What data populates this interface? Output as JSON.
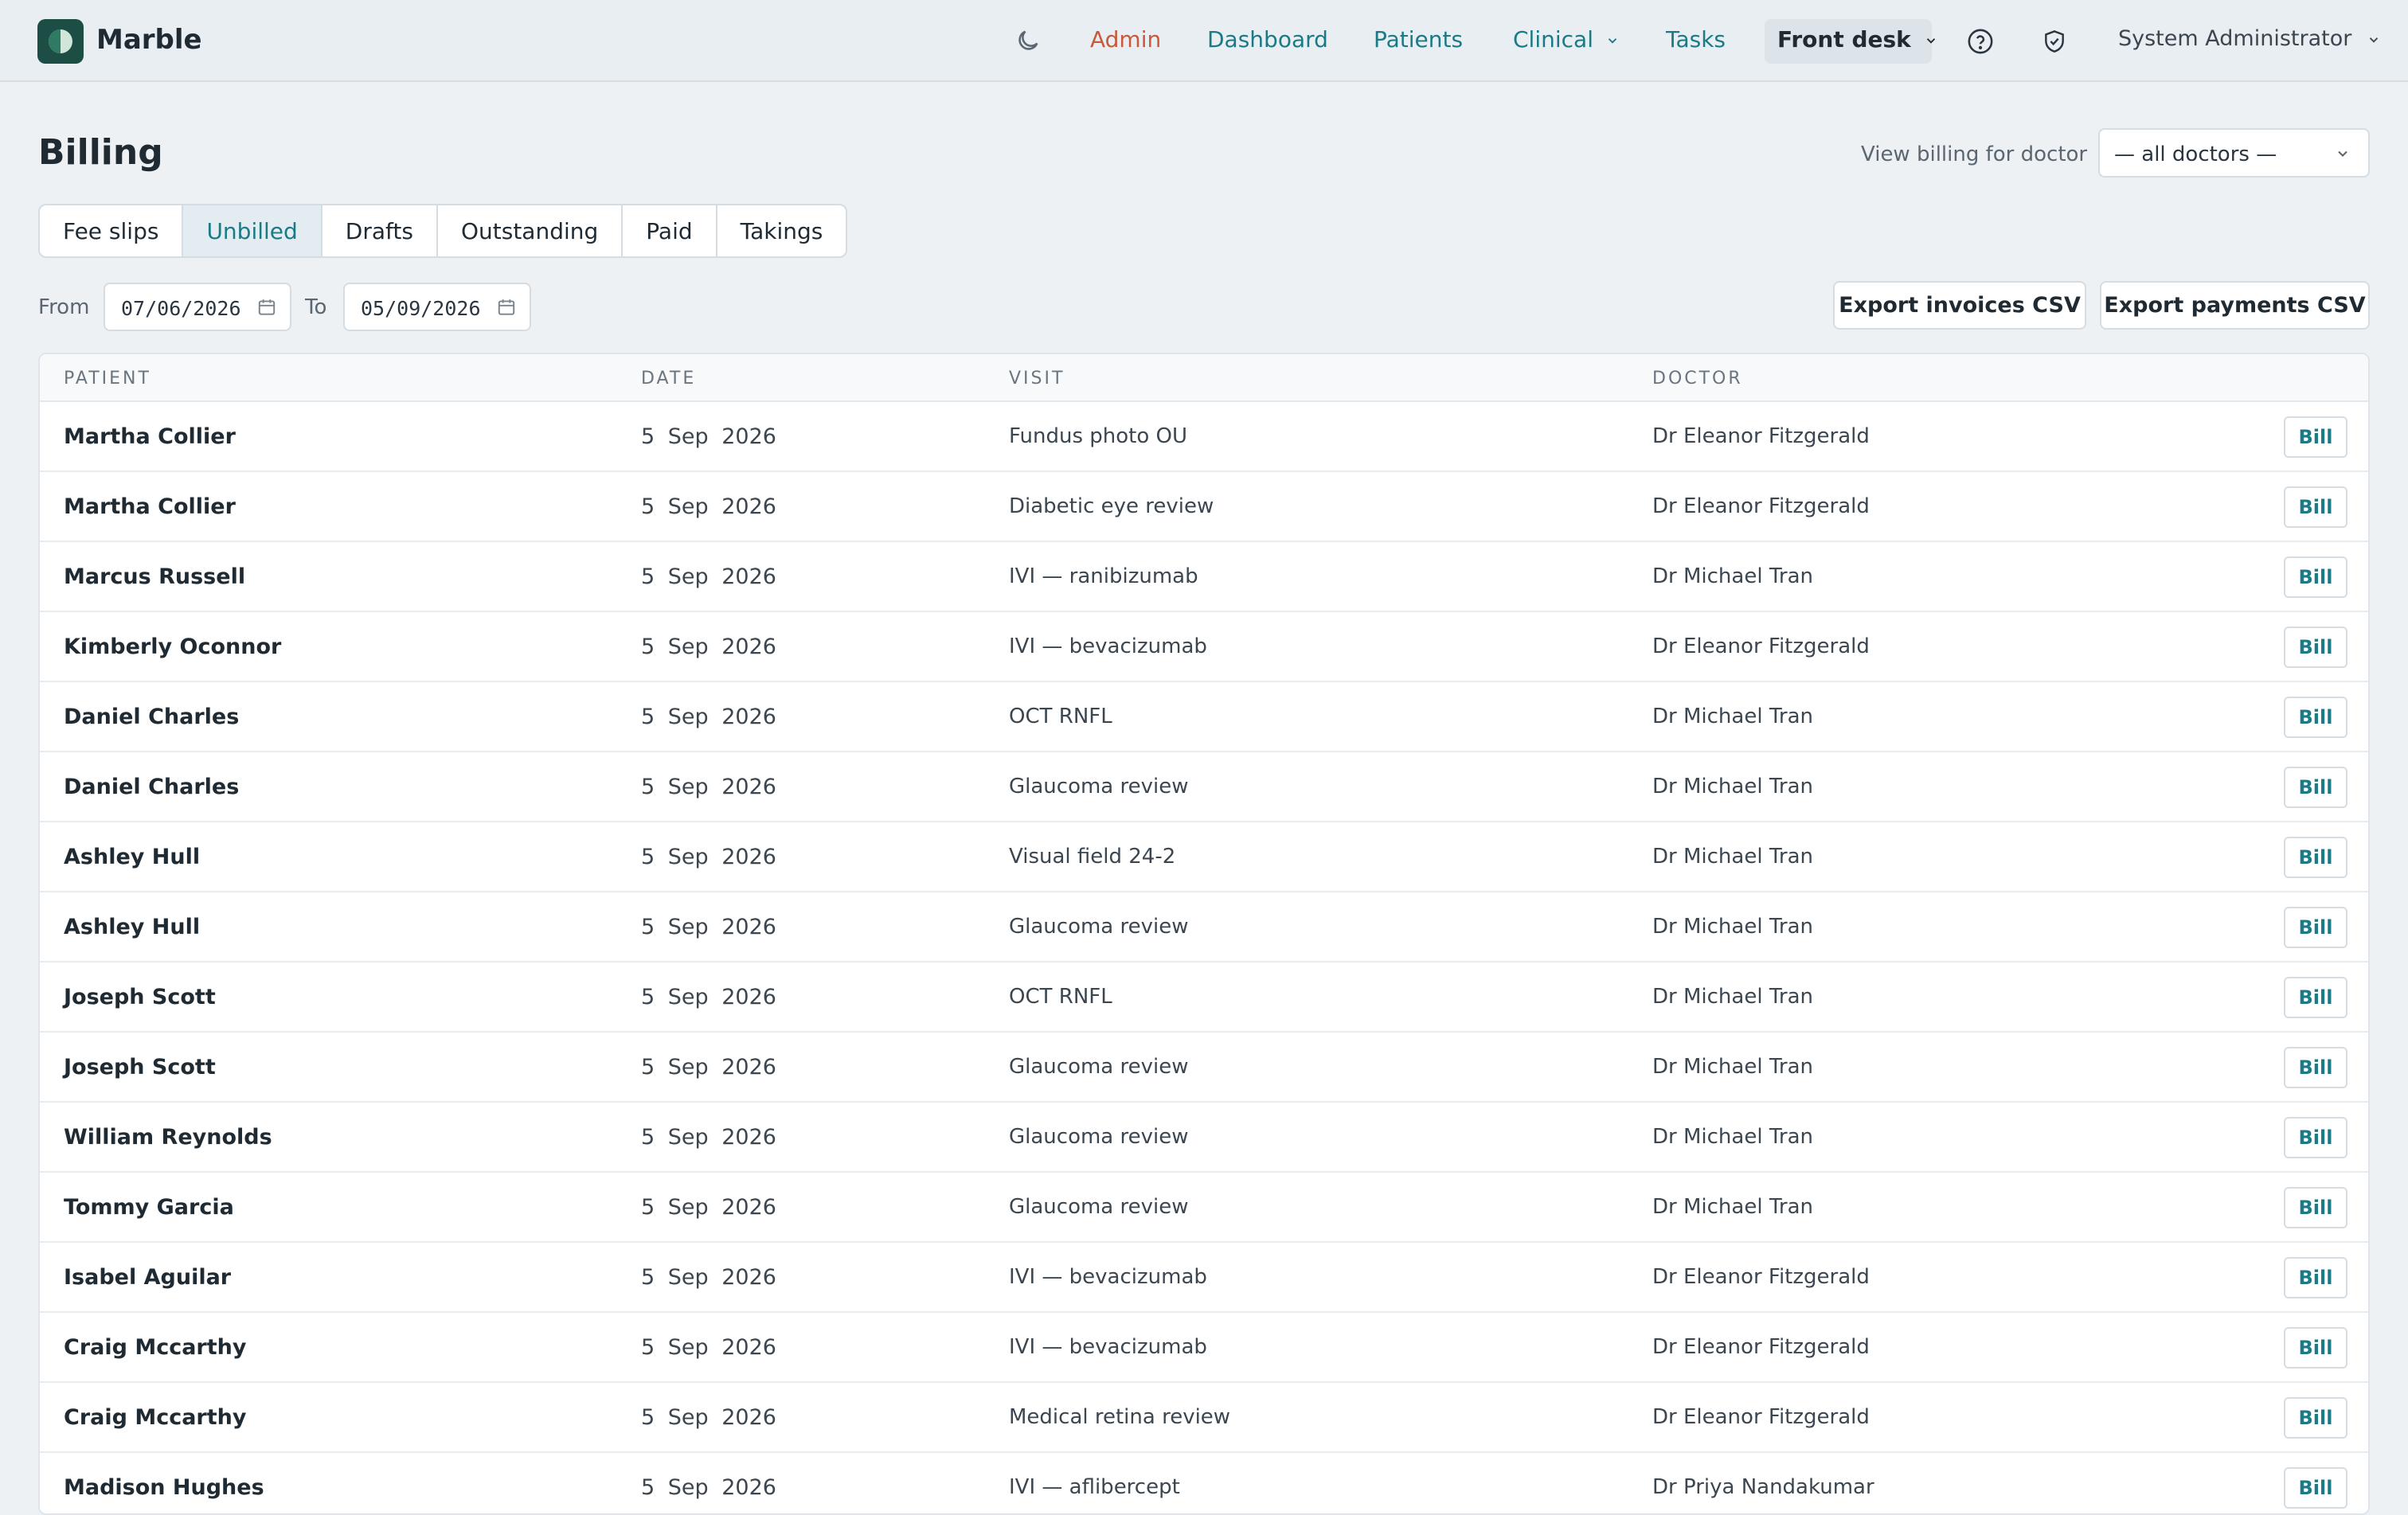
{
  "app": {
    "name": "Marble"
  },
  "nav": {
    "items": [
      {
        "label": "Admin"
      },
      {
        "label": "Dashboard"
      },
      {
        "label": "Patients"
      },
      {
        "label": "Clinical"
      },
      {
        "label": "Tasks"
      },
      {
        "label": "Front desk"
      }
    ],
    "user": "System Administrator"
  },
  "page": {
    "title": "Billing",
    "doctor_filter_label": "View billing for doctor",
    "doctor_filter_value": "— all doctors —"
  },
  "tabs": [
    {
      "label": "Fee slips"
    },
    {
      "label": "Unbilled",
      "active": true
    },
    {
      "label": "Drafts"
    },
    {
      "label": "Outstanding"
    },
    {
      "label": "Paid"
    },
    {
      "label": "Takings"
    }
  ],
  "filters": {
    "from_label": "From",
    "from_value": "07/06/2026",
    "to_label": "To",
    "to_value": "05/09/2026",
    "export_invoices": "Export invoices CSV",
    "export_payments": "Export payments CSV"
  },
  "table": {
    "columns": [
      "PATIENT",
      "DATE",
      "VISIT",
      "DOCTOR"
    ],
    "bill_label": "Bill",
    "rows": [
      {
        "patient": "Martha Collier",
        "date": "5 Sep 2026",
        "visit": "Fundus photo OU",
        "doctor": "Dr Eleanor Fitzgerald"
      },
      {
        "patient": "Martha Collier",
        "date": "5 Sep 2026",
        "visit": "Diabetic eye review",
        "doctor": "Dr Eleanor Fitzgerald"
      },
      {
        "patient": "Marcus Russell",
        "date": "5 Sep 2026",
        "visit": "IVI — ranibizumab",
        "doctor": "Dr Michael Tran"
      },
      {
        "patient": "Kimberly Oconnor",
        "date": "5 Sep 2026",
        "visit": "IVI — bevacizumab",
        "doctor": "Dr Eleanor Fitzgerald"
      },
      {
        "patient": "Daniel Charles",
        "date": "5 Sep 2026",
        "visit": "OCT RNFL",
        "doctor": "Dr Michael Tran"
      },
      {
        "patient": "Daniel Charles",
        "date": "5 Sep 2026",
        "visit": "Glaucoma review",
        "doctor": "Dr Michael Tran"
      },
      {
        "patient": "Ashley Hull",
        "date": "5 Sep 2026",
        "visit": "Visual field 24-2",
        "doctor": "Dr Michael Tran"
      },
      {
        "patient": "Ashley Hull",
        "date": "5 Sep 2026",
        "visit": "Glaucoma review",
        "doctor": "Dr Michael Tran"
      },
      {
        "patient": "Joseph Scott",
        "date": "5 Sep 2026",
        "visit": "OCT RNFL",
        "doctor": "Dr Michael Tran"
      },
      {
        "patient": "Joseph Scott",
        "date": "5 Sep 2026",
        "visit": "Glaucoma review",
        "doctor": "Dr Michael Tran"
      },
      {
        "patient": "William Reynolds",
        "date": "5 Sep 2026",
        "visit": "Glaucoma review",
        "doctor": "Dr Michael Tran"
      },
      {
        "patient": "Tommy Garcia",
        "date": "5 Sep 2026",
        "visit": "Glaucoma review",
        "doctor": "Dr Michael Tran"
      },
      {
        "patient": "Isabel Aguilar",
        "date": "5 Sep 2026",
        "visit": "IVI — bevacizumab",
        "doctor": "Dr Eleanor Fitzgerald"
      },
      {
        "patient": "Craig Mccarthy",
        "date": "5 Sep 2026",
        "visit": "IVI — bevacizumab",
        "doctor": "Dr Eleanor Fitzgerald"
      },
      {
        "patient": "Craig Mccarthy",
        "date": "5 Sep 2026",
        "visit": "Medical retina review",
        "doctor": "Dr Eleanor Fitzgerald"
      },
      {
        "patient": "Madison Hughes",
        "date": "5 Sep 2026",
        "visit": "IVI — aflibercept",
        "doctor": "Dr Priya Nandakumar"
      }
    ]
  }
}
